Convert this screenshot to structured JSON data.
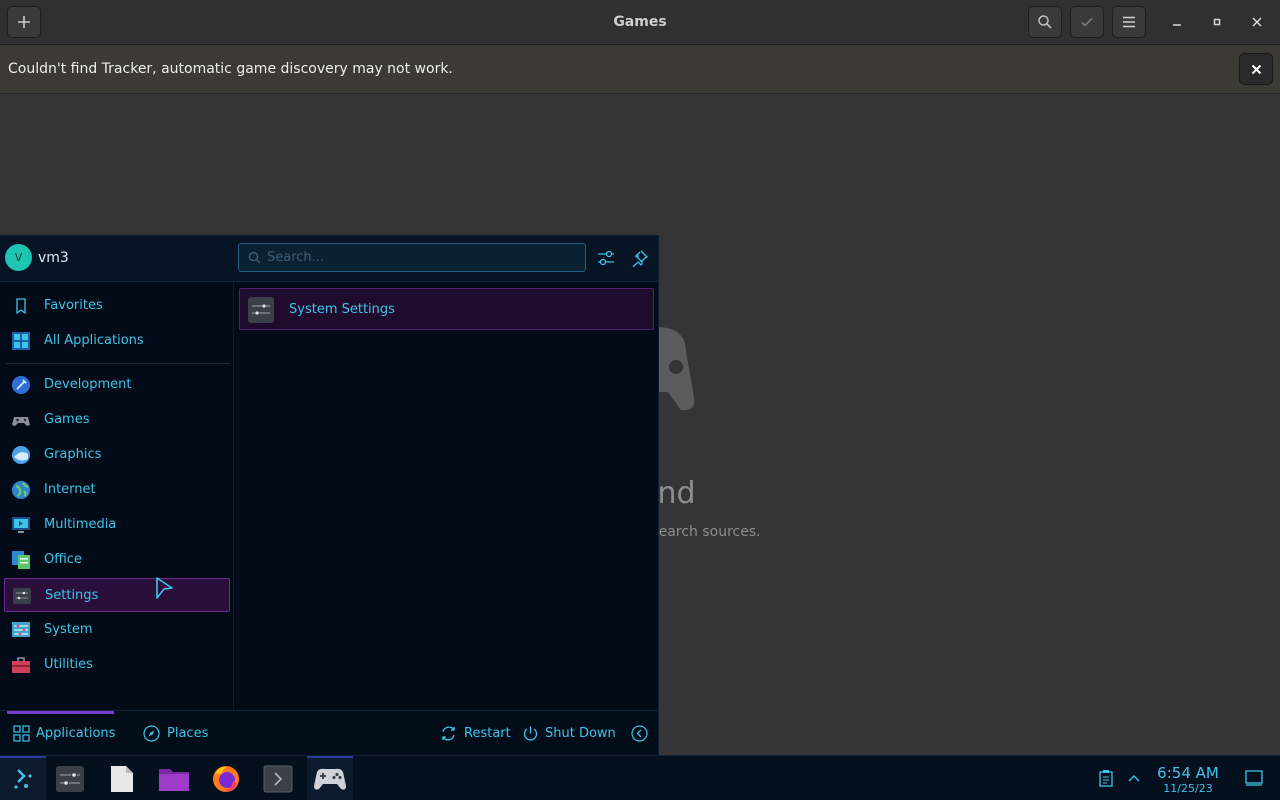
{
  "window": {
    "title": "Games",
    "infobar_message": "Couldn't find Tracker, automatic game discovery may not work.",
    "empty_title": "s found",
    "empty_subtitle": "ing games to your search sources."
  },
  "launcher": {
    "user": {
      "avatar_letter": "V",
      "name": "vm3"
    },
    "search_placeholder": "Search...",
    "sidebar": {
      "top_items": [
        {
          "label": "Favorites",
          "icon": "bookmark-icon"
        },
        {
          "label": "All Applications",
          "icon": "grid-icon"
        }
      ],
      "categories": [
        {
          "label": "Development",
          "icon": "development-icon"
        },
        {
          "label": "Games",
          "icon": "gamepad-icon"
        },
        {
          "label": "Graphics",
          "icon": "graphics-icon"
        },
        {
          "label": "Internet",
          "icon": "globe-icon"
        },
        {
          "label": "Multimedia",
          "icon": "multimedia-icon"
        },
        {
          "label": "Office",
          "icon": "office-icon"
        },
        {
          "label": "Settings",
          "icon": "settings-icon",
          "selected": true
        },
        {
          "label": "System",
          "icon": "system-icon"
        },
        {
          "label": "Utilities",
          "icon": "toolbox-icon"
        }
      ]
    },
    "results": [
      {
        "label": "System Settings",
        "icon": "system-settings-icon"
      }
    ],
    "footer": {
      "applications_label": "Applications",
      "places_label": "Places",
      "restart_label": "Restart",
      "shutdown_label": "Shut Down"
    }
  },
  "taskbar": {
    "clock": {
      "time": "6:54 AM",
      "date": "11/25/23"
    }
  },
  "colors": {
    "accent_cyan": "#3ec4e6",
    "selection_purple": "#6a2c8c",
    "launcher_bg": "#020b17",
    "window_bg": "#353535"
  }
}
